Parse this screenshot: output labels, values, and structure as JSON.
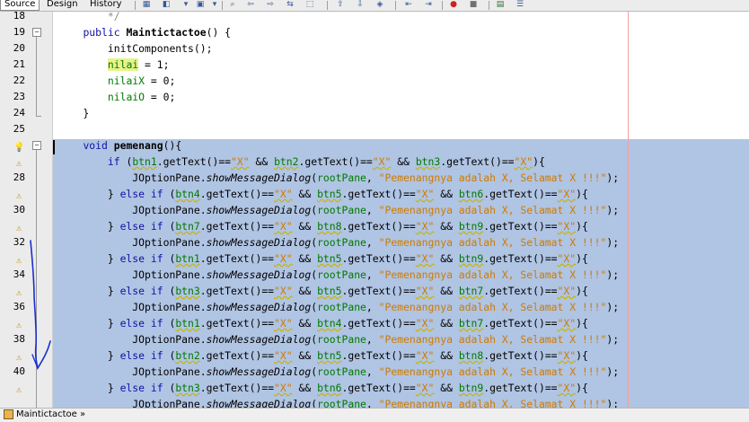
{
  "toolbar": {
    "tabs": [
      {
        "label": "Source",
        "active": true
      },
      {
        "label": "Design",
        "active": false
      },
      {
        "label": "History",
        "active": false
      }
    ],
    "icons": [
      "last-edit-icon",
      "back-icon",
      "forward-icon",
      "search-icon",
      "find-previous-icon",
      "find-next-icon",
      "find-selection-icon",
      "toggle-highlight-icon",
      "toggle-rect-selection-icon",
      "previous-bookmark-icon",
      "next-bookmark-icon",
      "toggle-bookmark-icon",
      "shift-left-icon",
      "shift-right-icon",
      "start-macro-icon",
      "stop-macro-icon",
      "comment-icon",
      "uncomment-icon"
    ]
  },
  "gutter": {
    "line_numbers": [
      "18",
      "19",
      "20",
      "21",
      "22",
      "23",
      "24",
      "25",
      "",
      "",
      "28",
      "",
      "30",
      "",
      "32",
      "",
      "34",
      "",
      "36",
      "",
      "38",
      "",
      "40",
      ""
    ]
  },
  "code_lines": [
    "        */",
    "    public Maintictactoe() {",
    "        initComponents();",
    "        nilai = 1;",
    "        nilaiX = 0;",
    "        nilaiO = 0;",
    "    }",
    "",
    "    void pemenang(){",
    "        if (btn1.getText()==\"X\" && btn2.getText()==\"X\" && btn3.getText()==\"X\"){",
    "            JOptionPane.showMessageDialog(rootPane, \"Pemenangnya adalah X, Selamat X !!!\");",
    "        } else if (btn4.getText()==\"X\" && btn5.getText()==\"X\" && btn6.getText()==\"X\"){",
    "            JOptionPane.showMessageDialog(rootPane, \"Pemenangnya adalah X, Selamat X !!!\");",
    "        } else if (btn7.getText()==\"X\" && btn8.getText()==\"X\" && btn9.getText()==\"X\"){",
    "            JOptionPane.showMessageDialog(rootPane, \"Pemenangnya adalah X, Selamat X !!!\");",
    "        } else if (btn1.getText()==\"X\" && btn5.getText()==\"X\" && btn9.getText()==\"X\"){",
    "            JOptionPane.showMessageDialog(rootPane, \"Pemenangnya adalah X, Selamat X !!!\");",
    "        } else if (btn3.getText()==\"X\" && btn5.getText()==\"X\" && btn7.getText()==\"X\"){",
    "            JOptionPane.showMessageDialog(rootPane, \"Pemenangnya adalah X, Selamat X !!!\");",
    "        } else if (btn1.getText()==\"X\" && btn4.getText()==\"X\" && btn7.getText()==\"X\"){",
    "            JOptionPane.showMessageDialog(rootPane, \"Pemenangnya adalah X, Selamat X !!!\");",
    "        } else if (btn2.getText()==\"X\" && btn5.getText()==\"X\" && btn8.getText()==\"X\"){",
    "            JOptionPane.showMessageDialog(rootPane, \"Pemenangnya adalah X, Selamat X !!!\");",
    "        } else if (btn3.getText()==\"X\" && btn6.getText()==\"X\" && btn9.getText()==\"X\"){",
    "            JOptionPane.showMessageDialog(rootPane, \"Pemenangnya adalah X, Selamat X !!!\");"
  ],
  "statusbar": {
    "breadcrumb": "Maintictactoe",
    "breadcrumb_arrow": "»"
  },
  "colors": {
    "selection": "#b0c4e3",
    "keyword": "#1010a8",
    "field": "#007a00",
    "string": "#ce7b00"
  }
}
